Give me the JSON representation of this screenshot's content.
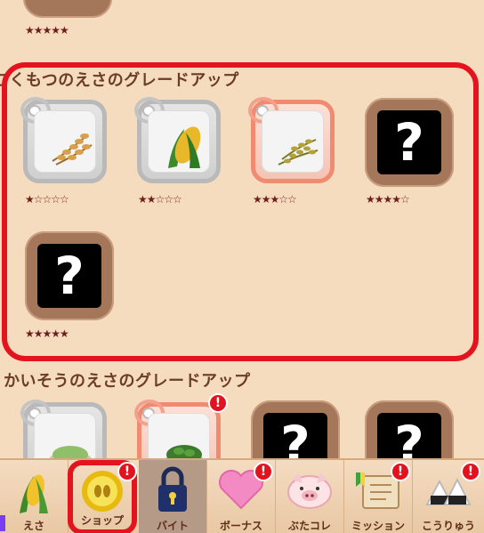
{
  "sections": {
    "prev_stars": "★★★★★",
    "grain": {
      "title": "こくもつのえさのグレードアップ",
      "items": [
        {
          "name": "wheat",
          "stars": "★☆☆☆☆",
          "selected": false,
          "locked": false
        },
        {
          "name": "corn",
          "stars": "★★☆☆☆",
          "selected": false,
          "locked": false
        },
        {
          "name": "rice",
          "stars": "★★★☆☆",
          "selected": true,
          "locked": false
        },
        {
          "name": "locked-4",
          "stars": "★★★★☆",
          "locked": true,
          "mark": "?"
        },
        {
          "name": "locked-5",
          "stars": "★★★★★",
          "locked": true,
          "mark": "?"
        }
      ]
    },
    "seaweed": {
      "title": "かいそうのえさのグレードアップ",
      "locked_mark": "?"
    }
  },
  "alert_mark": "!",
  "bottom_tabs": [
    {
      "label": "えさ",
      "icon": "corn-icon",
      "alert": false
    },
    {
      "label": "ショップ",
      "icon": "coin-icon",
      "alert": true
    },
    {
      "label": "バイト",
      "icon": "lock-icon",
      "alert": false
    },
    {
      "label": "ボーナス",
      "icon": "heart-icon",
      "alert": true
    },
    {
      "label": "ぶたコレ",
      "icon": "pig-icon",
      "alert": false
    },
    {
      "label": "ミッション",
      "icon": "scroll-icon",
      "alert": true
    },
    {
      "label": "こうりゅう",
      "icon": "rice-ball-icon",
      "alert": true
    }
  ],
  "colors": {
    "background": "#f6dcbf",
    "highlight": "#e4141f",
    "locked": "#000000",
    "star": "#6d1f1f"
  }
}
